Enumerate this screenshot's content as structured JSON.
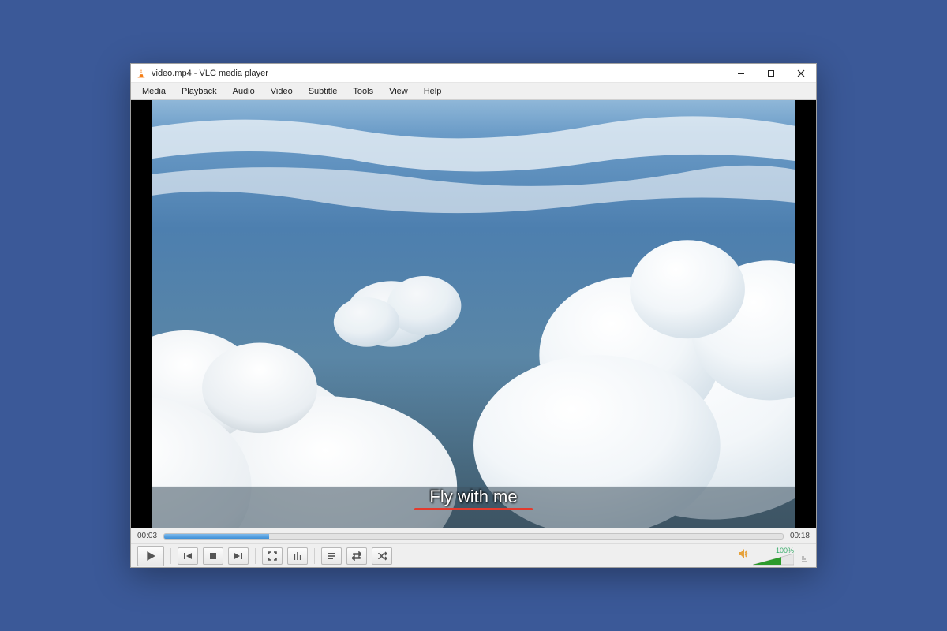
{
  "window": {
    "title": "video.mp4 - VLC media player"
  },
  "menu": {
    "items": [
      "Media",
      "Playback",
      "Audio",
      "Video",
      "Subtitle",
      "Tools",
      "View",
      "Help"
    ]
  },
  "subtitle": {
    "text": "Fly with me"
  },
  "playback": {
    "elapsed": "00:03",
    "total": "00:18",
    "progress_percent": 17
  },
  "volume": {
    "label": "100%",
    "level_percent": 100
  },
  "icons": {
    "play": "play-icon",
    "prev": "previous-icon",
    "stop": "stop-icon",
    "next": "next-icon",
    "fullscreen": "fullscreen-icon",
    "equalizer": "equalizer-icon",
    "playlist": "playlist-icon",
    "loop": "loop-icon",
    "shuffle": "shuffle-icon",
    "speaker": "speaker-icon"
  },
  "colors": {
    "page_bg": "#3b5998",
    "seek_fill": "#3d8fd6",
    "subtitle_underline": "#e33b2e",
    "volume_fill": "#2c9b2c"
  }
}
